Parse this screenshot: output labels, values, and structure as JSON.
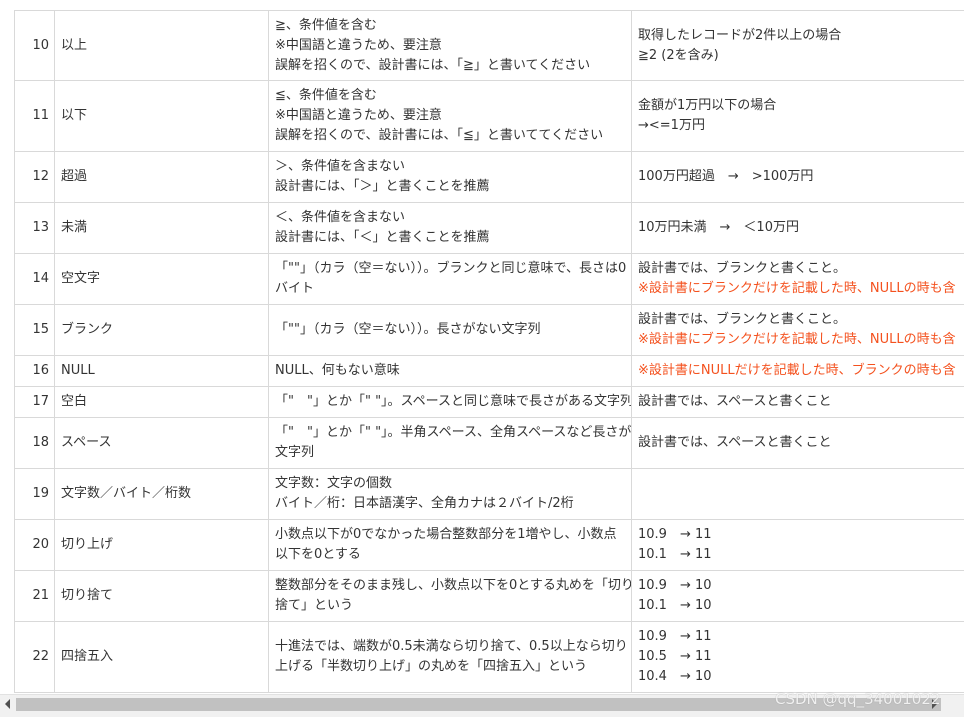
{
  "rows": [
    {
      "no": "10",
      "term": "以上",
      "desc": [
        "≧、条件値を含む",
        "※中国語と違うため、要注意",
        "誤解を招くので、設計書には、「≧」と書いてください"
      ],
      "example": [
        "取得したレコードが2件以上の場合",
        "≧2 (2を含み)"
      ],
      "example_red": []
    },
    {
      "no": "11",
      "term": "以下",
      "desc": [
        "≦、条件値を含む",
        "※中国語と違うため、要注意",
        "誤解を招くので、設計書には、「≦」と書いててください"
      ],
      "example": [
        "金額が1万円以下の場合",
        "→<=1万円"
      ],
      "example_red": []
    },
    {
      "no": "12",
      "term": "超過",
      "desc": [
        "＞、条件値を含まない",
        "設計書には、「＞」と書くことを推薦"
      ],
      "example": [
        "100万円超過　→　>100万円"
      ],
      "example_red": []
    },
    {
      "no": "13",
      "term": "未満",
      "desc": [
        "＜、条件値を含まない",
        "設計書には、「＜」と書くことを推薦"
      ],
      "example": [
        "10万円未満　→　＜10万円"
      ],
      "example_red": []
    },
    {
      "no": "14",
      "term": "空文字",
      "desc": [
        "「\"\"」（カラ（空＝ない））。ブランクと同じ意味で、長さは0",
        "バイト"
      ],
      "example": [
        "設計書では、ブランクと書くこと。"
      ],
      "example_red": [
        "※設計書にブランクだけを記載した時、NULLの時も含"
      ]
    },
    {
      "no": "15",
      "term": "ブランク",
      "desc": [
        "「\"\"」（カラ（空＝ない））。長さがない文字列"
      ],
      "example": [
        "設計書では、ブランクと書くこと。"
      ],
      "example_red": [
        "※設計書にブランクだけを記載した時、NULLの時も含"
      ]
    },
    {
      "no": "16",
      "term": "NULL",
      "desc": [
        "NULL、何もない意味"
      ],
      "example": [],
      "example_red": [
        "※設計書にNULLだけを記載した時、ブランクの時も含"
      ]
    },
    {
      "no": "17",
      "term": "空白",
      "desc": [
        "「\"　\"」とか「\" \"」。スペースと同じ意味で長さがある文字列"
      ],
      "example": [
        "設計書では、スペースと書くこと"
      ],
      "example_red": []
    },
    {
      "no": "18",
      "term": "スペース",
      "desc": [
        "「\"　\"」とか「\" \"」。半角スペース、全角スペースなど長さがある",
        "文字列"
      ],
      "example": [
        "設計書では、スペースと書くこと"
      ],
      "example_red": []
    },
    {
      "no": "19",
      "term": "文字数／バイト／桁数",
      "desc": [
        "文字数：文字の個数",
        "バイト／桁：日本語漢字、全角カナは２バイト/2桁"
      ],
      "example": [],
      "example_red": []
    },
    {
      "no": "20",
      "term": "切り上げ",
      "desc": [
        "小数点以下が0でなかった場合整数部分を1増やし、小数点",
        "以下を0とする"
      ],
      "example": [
        "10.9　→ 11",
        "10.1　→ 11"
      ],
      "example_red": []
    },
    {
      "no": "21",
      "term": "切り捨て",
      "desc": [
        "整数部分をそのまま残し、小数点以下を0とする丸めを「切り",
        "捨て」という"
      ],
      "example": [
        "10.9　→ 10",
        "10.1　→ 10"
      ],
      "example_red": []
    },
    {
      "no": "22",
      "term": "四捨五入",
      "desc": [
        "十進法では、端数が0.5未満なら切り捨て、0.5以上なら切り",
        "上げる「半数切り上げ」の丸めを「四捨五入」という"
      ],
      "example": [
        "10.9　→ 11",
        "10.5　→ 11",
        "10.4　→ 10"
      ],
      "example_red": []
    }
  ],
  "watermark": "CSDN @qq_34001022",
  "colors": {
    "accent_red": "#f4511e",
    "border": "#d9d9d9"
  }
}
